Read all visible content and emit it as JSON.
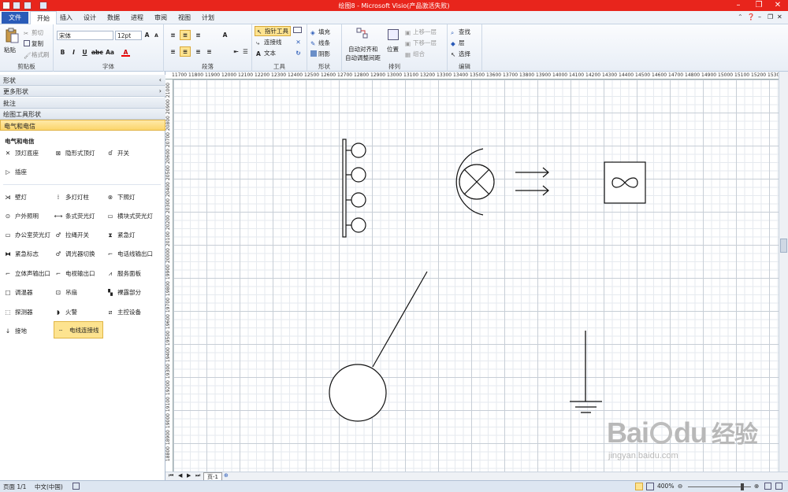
{
  "window": {
    "title": "绘图8 - Microsoft Visio(产品激活失败)"
  },
  "menu": {
    "file": "文件",
    "tabs": [
      "开始",
      "插入",
      "设计",
      "数据",
      "进程",
      "审阅",
      "视图",
      "计划"
    ]
  },
  "ribbon": {
    "clipboard": {
      "paste": "粘贴",
      "cut": "剪切",
      "copy": "复制",
      "format_painter": "格式刷",
      "label": "剪贴板"
    },
    "font": {
      "name": "宋体",
      "size": "12pt",
      "label": "字体"
    },
    "paragraph": {
      "label": "段落"
    },
    "tools": {
      "pointer": "指针工具",
      "connector": "连接线",
      "text": "文本",
      "label": "工具"
    },
    "shape": {
      "fill": "填充",
      "line": "线条",
      "shadow": "阴影",
      "label": "形状"
    },
    "arrange": {
      "auto_align": "自动对齐和",
      "auto_space": "自动调整间距",
      "position": "位置",
      "bring_forward": "上移一层",
      "send_backward": "下移一层",
      "group": "组合",
      "label": "排列"
    },
    "editing": {
      "find": "查找",
      "layer": "层",
      "select": "选择",
      "label": "编辑"
    }
  },
  "panel": {
    "headers": [
      "形状",
      "更多形状",
      "批注",
      "绘图工具形状",
      "电气和电信"
    ],
    "stencil_title": "电气和电信",
    "shapes": [
      "顶灯底座",
      "隐形式顶灯",
      "开关",
      "插座",
      "壁灯",
      "多灯灯柱",
      "下照灯",
      "户外照明",
      "条式荧光灯",
      "横块式荧光灯",
      "办公室荧光灯",
      "拉绳开关",
      "紧急灯",
      "紧急标志",
      "调光器切换",
      "电话线输出口",
      "立体声输出口",
      "电视输出口",
      "服务面板",
      "调温器",
      "吊扇",
      "裸露部分",
      "探测器",
      "火警",
      "主控设备",
      "接地",
      "电线连接线"
    ]
  },
  "ruler": {
    "top": [
      "11700",
      "11800",
      "11900",
      "12000",
      "12100",
      "12200",
      "12300",
      "12400",
      "12500",
      "12600",
      "12700",
      "12800",
      "12900",
      "13000",
      "13100",
      "13200",
      "13300",
      "13400",
      "13500",
      "13600",
      "13700",
      "13800",
      "13900",
      "14000",
      "14100",
      "14200",
      "14300",
      "14400",
      "14500",
      "14600",
      "14700",
      "14800",
      "14900",
      "15000",
      "15100",
      "15200",
      "15300"
    ],
    "left": [
      "21000",
      "20900",
      "20800",
      "20700",
      "20600",
      "20500",
      "20400",
      "20300",
      "20200",
      "20100",
      "20000",
      "19900",
      "19800",
      "19700",
      "19600",
      "19500",
      "19400",
      "19300",
      "19200",
      "19100",
      "19000",
      "18900",
      "18800"
    ]
  },
  "page_tab": "页-1",
  "status": {
    "page": "页面 1/1",
    "language": "中文(中国)",
    "zoom": "400%"
  },
  "watermark": {
    "brand": "Bai",
    "brand_mid": "du",
    "brand_cn": "经验",
    "url": "jingyan.baidu.com"
  }
}
